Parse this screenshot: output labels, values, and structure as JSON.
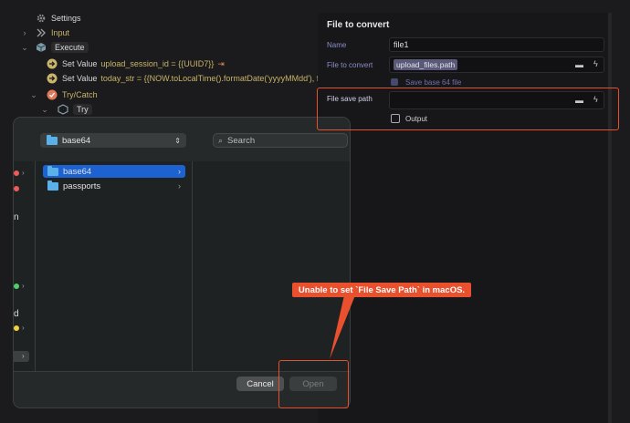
{
  "tree": {
    "settings": "Settings",
    "input": "Input",
    "execute": "Execute",
    "set1_prefix": "Set Value",
    "set1_expr": "upload_session_id = {{UUID7}}",
    "set2_prefix": "Set Value",
    "set2_expr": "today_str = {{NOW.toLocalTime().formatDate('yyyyMMdd'), fal",
    "trycatch": "Try/Catch",
    "try": "Try"
  },
  "panel": {
    "title": "File to convert",
    "name_label": "Name",
    "name_value": "file1",
    "file_label": "File to convert",
    "file_value": "upload_files.path",
    "save_b64_label": "Save base 64 file",
    "save_path_label": "File save path",
    "save_path_value": "",
    "output_label": "Output"
  },
  "dialog": {
    "folder": "base64",
    "search_placeholder": "Search",
    "items": [
      "base64",
      "passports"
    ],
    "cancel": "Cancel",
    "open": "Open",
    "sidebar_partial_letters": [
      "n",
      "d"
    ]
  },
  "annotation": {
    "callout": "Unable to set `File Save Path` in macOS."
  },
  "colors": {
    "accent_red": "#e94e2d",
    "selection_blue": "#1d62d1",
    "folder_blue": "#5ab0e8"
  }
}
